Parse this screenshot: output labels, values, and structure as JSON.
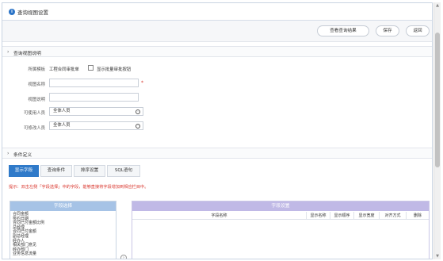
{
  "window": {
    "title": "查询视图设置"
  },
  "toolbar": {
    "view_results_label": "查看查询结果",
    "save_label": "保存",
    "back_label": "返回"
  },
  "section_view": {
    "title": "查询视图说明",
    "template_label": "所属模板",
    "template_value": "工程合同审批单",
    "batch_approve_label": "显示批量审批按钮",
    "view_name_label": "视图名称",
    "required_mark": "*",
    "view_desc_label": "视图说明",
    "usable_by_label": "可使用人员",
    "usable_by_value": "全体人员",
    "editable_by_label": "可修改人员",
    "editable_by_value": "全体人员"
  },
  "section_condition": {
    "title": "条件定义",
    "tabs": [
      "显示字段",
      "查询条件",
      "排序设置",
      "SQL语句"
    ],
    "active_tab_index": 0,
    "hint": "提示：双击左侧「字段选择」中的字段，能够直接将字段增加到相应栏目中。"
  },
  "field_selection": {
    "title": "字段选择",
    "items": [
      "合同金额",
      "签约日期",
      "合同已付金额比例",
      "总经理",
      "合同已付金额",
      "副总经理",
      "经办人",
      "相关部门意见",
      "经办部门",
      "业务信息流量"
    ]
  },
  "field_settings": {
    "title": "字段设置",
    "columns": [
      "字段名称",
      "显示名称",
      "显示顺序",
      "显示宽度",
      "对齐方式",
      "删除"
    ]
  },
  "icons": {
    "title": "info-circle-icon",
    "select": "select-circle-icon",
    "move": "move-right-icon"
  },
  "colors": {
    "accent": "#2f7ac9",
    "field_header": "#a6c3e6",
    "settings_header": "#c0b9e6",
    "hint": "#d9342b"
  }
}
